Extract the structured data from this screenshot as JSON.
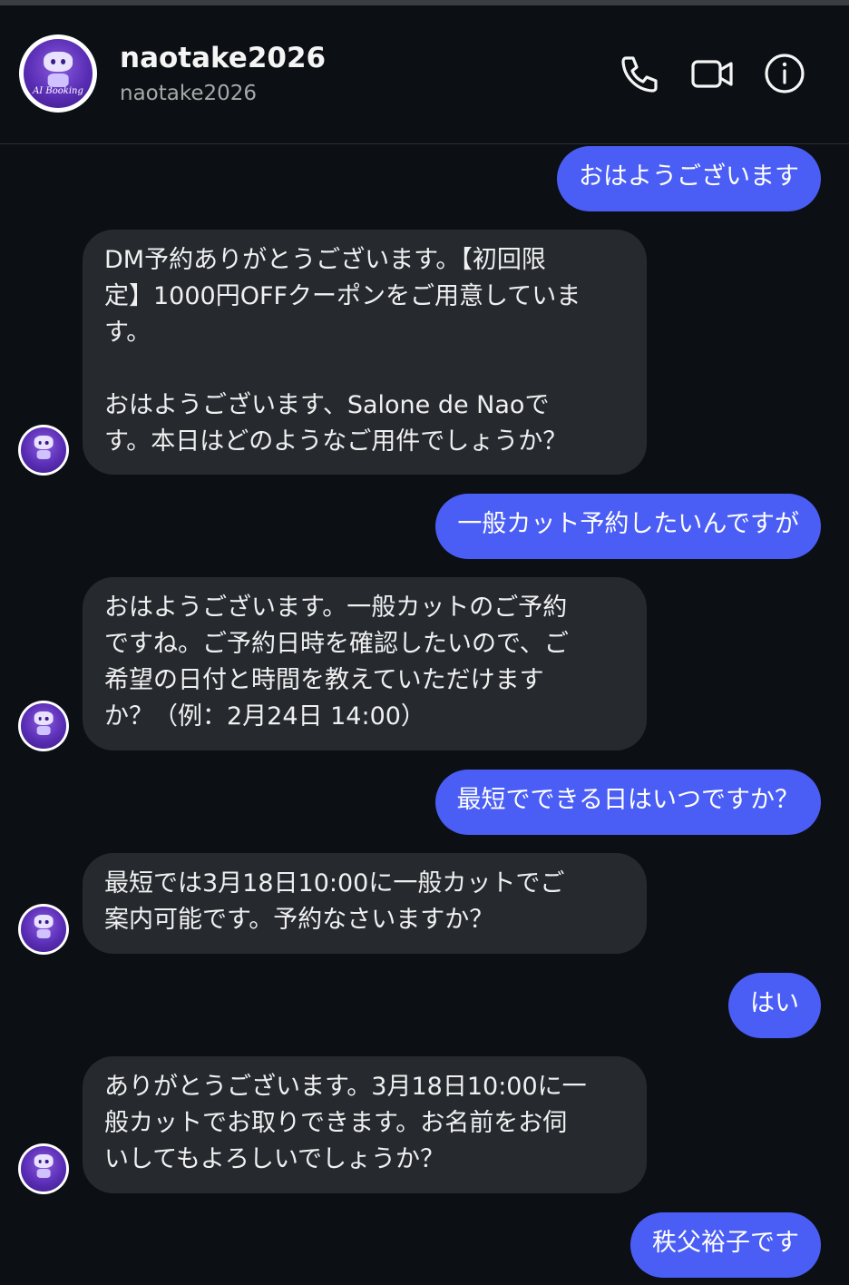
{
  "contact": {
    "name": "naotake2026",
    "handle": "naotake2026",
    "avatar_text": "AI Booking"
  },
  "header_icons": [
    "phone-icon",
    "video-camera-icon",
    "info-icon"
  ],
  "colors": {
    "background": "#0c1014",
    "outgoing_bubble": "#4a5ef5",
    "incoming_bubble": "#262a2f"
  },
  "messages": [
    {
      "from": "me",
      "text": "おはようございます"
    },
    {
      "from": "them",
      "text": "DM予約ありがとうございます。【初回限\n定】1000円OFFクーポンをご用意していま\nす。\n\nおはようございます、Salone de Naoで\nす。本日はどのようなご用件でしょうか？"
    },
    {
      "from": "me",
      "text": "一般カット予約したいんですが"
    },
    {
      "from": "them",
      "text": "おはようございます。一般カットのご予約\nですね。ご予約日時を確認したいので、ご\n希望の日付と時間を教えていただけます\nか？（例：2月24日 14:00）"
    },
    {
      "from": "me",
      "text": "最短でできる日はいつですか？"
    },
    {
      "from": "them",
      "text": "最短では3月18日10:00に一般カットでご\n案内可能です。予約なさいますか？"
    },
    {
      "from": "me",
      "text": "はい"
    },
    {
      "from": "them",
      "text": "ありがとうございます。3月18日10:00に一\n般カットでお取りできます。お名前をお伺\nいしてもよろしいでしょうか？"
    },
    {
      "from": "me",
      "text": "秩父裕子です"
    }
  ]
}
